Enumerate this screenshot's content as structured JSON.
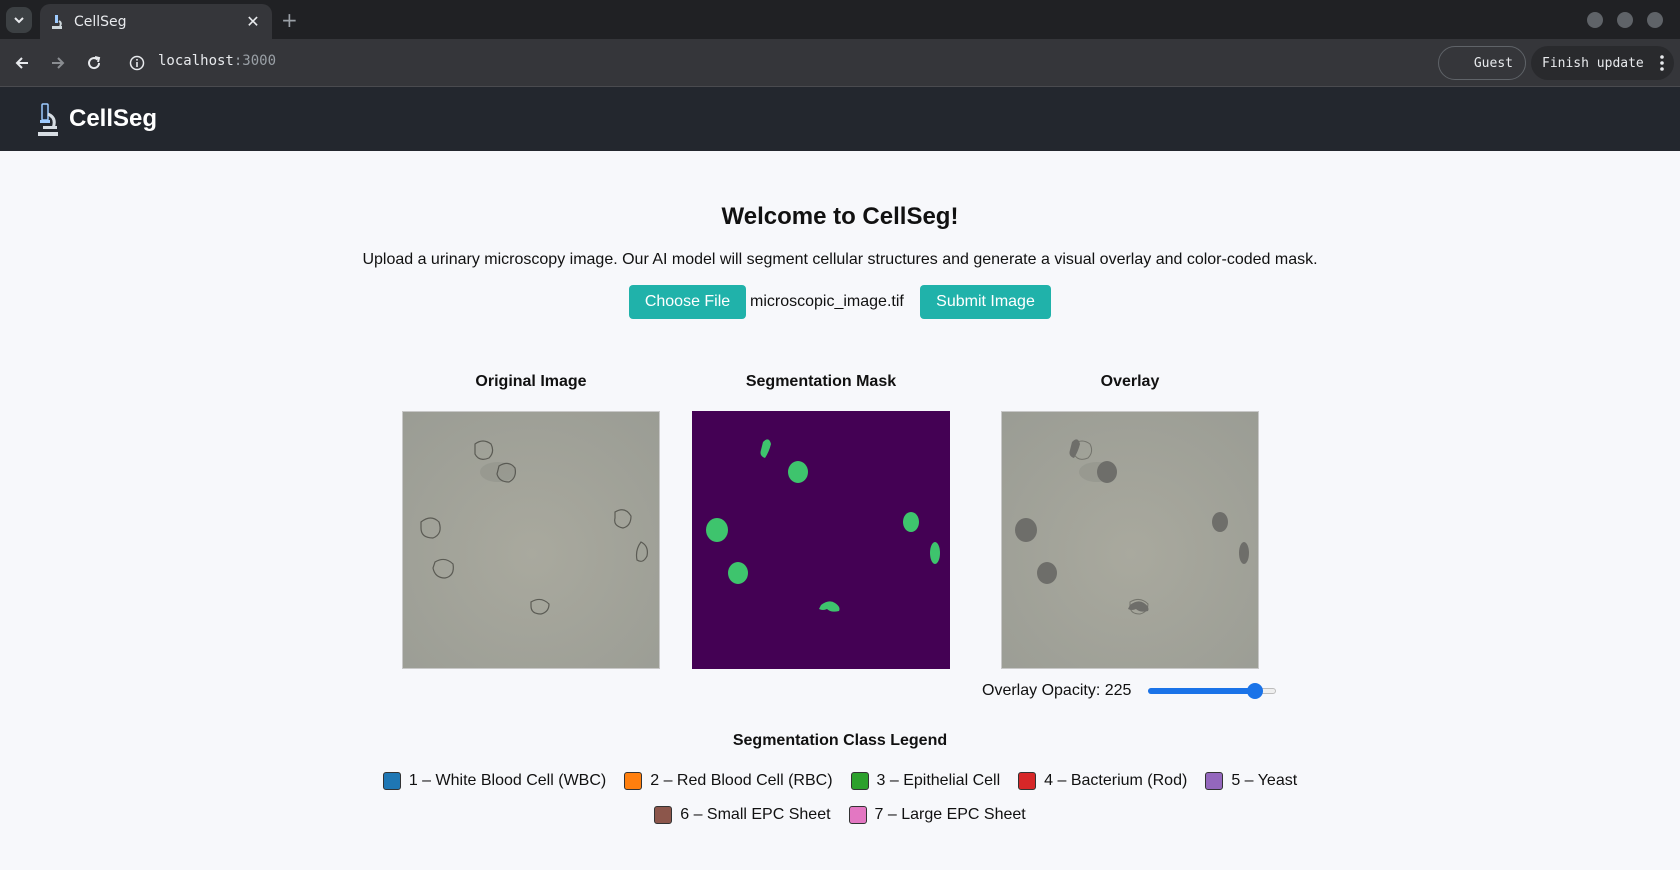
{
  "browser": {
    "tab_title": "CellSeg",
    "url_host": "localhost",
    "url_port": ":3000",
    "guest_label": "Guest",
    "finish_update_label": "Finish update"
  },
  "app": {
    "brand": "CellSeg"
  },
  "main": {
    "heading": "Welcome to CellSeg!",
    "description": "Upload a urinary microscopy image. Our AI model will segment cellular structures and generate a visual overlay and color-coded mask.",
    "choose_file_label": "Choose File",
    "file_name": "microscopic_image.tif",
    "submit_label": "Submit Image",
    "panels": {
      "original_title": "Original Image",
      "mask_title": "Segmentation Mask",
      "overlay_title": "Overlay"
    },
    "opacity": {
      "label": "Overlay Opacity: 225",
      "value": 225,
      "max": 255
    }
  },
  "legend": {
    "title": "Segmentation Class Legend",
    "row1": [
      {
        "label": "1 – White Blood Cell (WBC)",
        "color": "#1f77b4"
      },
      {
        "label": "2 – Red Blood Cell (RBC)",
        "color": "#ff7f0e"
      },
      {
        "label": "3 – Epithelial Cell",
        "color": "#2ca02c"
      },
      {
        "label": "4 – Bacterium (Rod)",
        "color": "#d62728"
      },
      {
        "label": "5 – Yeast",
        "color": "#9467bd"
      }
    ],
    "row2": [
      {
        "label": "6 – Small EPC Sheet",
        "color": "#8c564b"
      },
      {
        "label": "7 – Large EPC Sheet",
        "color": "#e377c2"
      }
    ]
  },
  "colors": {
    "accent": "#20b2aa",
    "mask_background": "#440154",
    "mask_cell": "#3ec46d",
    "appbar": "#23272e"
  }
}
